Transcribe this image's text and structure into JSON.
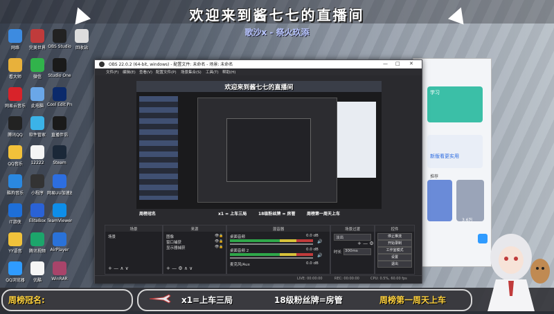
{
  "banner": {
    "title": "欢迎来到酱七七的直播间",
    "subtitle": "歌沙x - 祭火玖添"
  },
  "desktop": {
    "icons": [
      {
        "label": "网络",
        "color": "#3d8be0"
      },
      {
        "label": "看大师",
        "color": "#e8b13b"
      },
      {
        "label": "网易云音乐",
        "color": "#d8232a"
      },
      {
        "label": "腾讯QQ",
        "color": "#222222"
      },
      {
        "label": "QQ音乐",
        "color": "#f2c13a"
      },
      {
        "label": "酷狗音乐",
        "color": "#2a88e0"
      },
      {
        "label": "IT游侠",
        "color": "#1e6fd9"
      },
      {
        "label": "YY语音",
        "color": "#f0c23b"
      },
      {
        "label": "QQ浏览器",
        "color": "#2f9bff"
      },
      {
        "label": "完美世界",
        "color": "#c03b3b"
      },
      {
        "label": "微信",
        "color": "#31b34b"
      },
      {
        "label": "此电脑",
        "color": "#6aa7e8"
      },
      {
        "label": "软件管家",
        "color": "#3bb3e8"
      },
      {
        "label": "12222",
        "color": "#f5f5f5"
      },
      {
        "label": "小程序",
        "color": "#333333"
      },
      {
        "label": "EliteBox",
        "color": "#2a62d6"
      },
      {
        "label": "腾讯视频",
        "color": "#1ca56b"
      },
      {
        "label": "优酷",
        "color": "#f5f5f5"
      },
      {
        "label": "OBS Studio",
        "color": "#222222"
      },
      {
        "label": "Studio One",
        "color": "#1a1a1a"
      },
      {
        "label": "Cool Edit Pro",
        "color": "#0b2a6b"
      },
      {
        "label": "直播伴侣",
        "color": "#1a1a1a"
      },
      {
        "label": "Steam",
        "color": "#1b2838"
      },
      {
        "label": "网易UU加速器",
        "color": "#2d6ee0"
      },
      {
        "label": "TeamViewer",
        "color": "#0e8ee9"
      },
      {
        "label": "AirPlayer",
        "color": "#2a72d8"
      },
      {
        "label": "WinRAR",
        "color": "#a8446a"
      },
      {
        "label": "回收站",
        "color": "#dddddd"
      }
    ]
  },
  "obs": {
    "title": "OBS 22.0.2 (64-bit, windows) - 配置文件: 未命名 - 场景: 未命名",
    "menu": [
      "文件(F)",
      "编辑(E)",
      "查看(V)",
      "配置文件(P)",
      "场景集合(S)",
      "工具(T)",
      "帮助(H)"
    ],
    "controls": {
      "minimize": "—",
      "maximize": "□",
      "close": "✕"
    },
    "preview": {
      "title": "欢迎来到酱七七的直播间",
      "bottom_texts": [
        "周榜冠名",
        "x1 = 上车三局",
        "18级粉丝牌 = 房管",
        "周榜第一周天上车"
      ]
    },
    "docks": {
      "scenes": {
        "title": "场景",
        "items": [
          "场景"
        ]
      },
      "sources": {
        "title": "来源",
        "items": [
          "图像",
          "窗口捕获",
          "显示器捕获"
        ]
      },
      "mixer": {
        "title": "混音器",
        "channels": [
          {
            "name": "桌面音频",
            "level": "0.0 dB"
          },
          {
            "name": "桌面音频 2",
            "level": "0.0 dB"
          },
          {
            "name": "麦克风/Aux",
            "level": "0.0 dB"
          }
        ]
      },
      "transitions": {
        "title": "场景过渡",
        "selected": "淡出",
        "duration_label": "时长",
        "duration": "300ms"
      },
      "controls": {
        "title": "控件",
        "buttons": [
          "停止推流",
          "开始录制",
          "工作室模式",
          "设置",
          "退出"
        ]
      }
    },
    "status": [
      "LIVE: 00:00:00",
      "REC: 00:00:00",
      "CPU: 0.5%, 60.00 fps"
    ]
  },
  "bottom_bar": {
    "left_label": "周榜冠名:",
    "item1": "x1=上车三局",
    "item2": "18级粉丝牌=房管",
    "item3": "周榜第一周天上车"
  },
  "browser": {
    "labels": [
      "学习",
      "新版看更实用",
      "推荐",
      "3.6万"
    ]
  }
}
